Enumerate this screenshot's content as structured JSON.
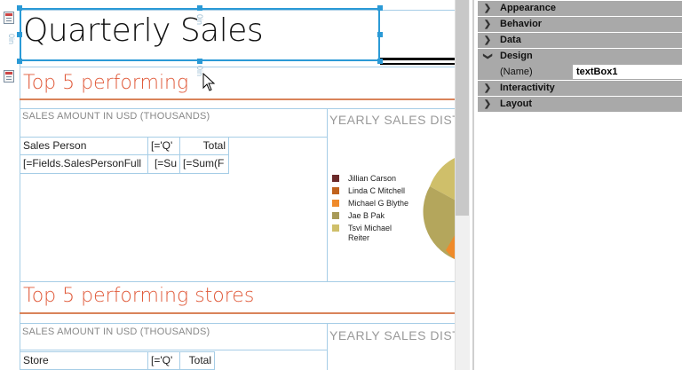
{
  "report": {
    "title": "Quarterly Sales",
    "ruler_marks": [
      "0in",
      "0in",
      "0in"
    ],
    "section1": {
      "heading": "Top 5 performing",
      "amount_label": "SALES AMOUNT IN USD (THOUSANDS)",
      "chart_label": "YEARLY SALES DISTR",
      "headers": [
        "Sales Person",
        "[='Q'",
        "Total"
      ],
      "row": [
        "[=Fields.SalesPersonFull",
        "[=Su",
        "[=Sum(F"
      ],
      "legend": [
        {
          "label": "Jillian  Carson",
          "color": "#6b2a2a"
        },
        {
          "label": "Linda C Mitchell",
          "color": "#c0621c"
        },
        {
          "label": "Michael G Blythe",
          "color": "#ef8a2a"
        },
        {
          "label": "Jae B Pak",
          "color": "#a89a58"
        },
        {
          "label": "Tsvi Michael Reiter",
          "color": "#cfbf6a"
        }
      ]
    },
    "section2": {
      "heading": "Top 5 performing stores",
      "amount_label": "SALES AMOUNT IN USD (THOUSANDS)",
      "chart_label": "YEARLY SALES DISTR",
      "headers": [
        "Store",
        "[='Q'",
        "Total"
      ]
    }
  },
  "properties": {
    "categories": [
      {
        "label": "Appearance",
        "expanded": false
      },
      {
        "label": "Behavior",
        "expanded": false
      },
      {
        "label": "Data",
        "expanded": false
      },
      {
        "label": "Design",
        "expanded": true
      },
      {
        "label": "Interactivity",
        "expanded": false
      },
      {
        "label": "Layout",
        "expanded": false
      }
    ],
    "design_row": {
      "name": "(Name)",
      "value": "textBox1"
    }
  },
  "icons": {
    "collapsed": "chevron-right-icon",
    "expanded": "chevron-down-icon"
  }
}
